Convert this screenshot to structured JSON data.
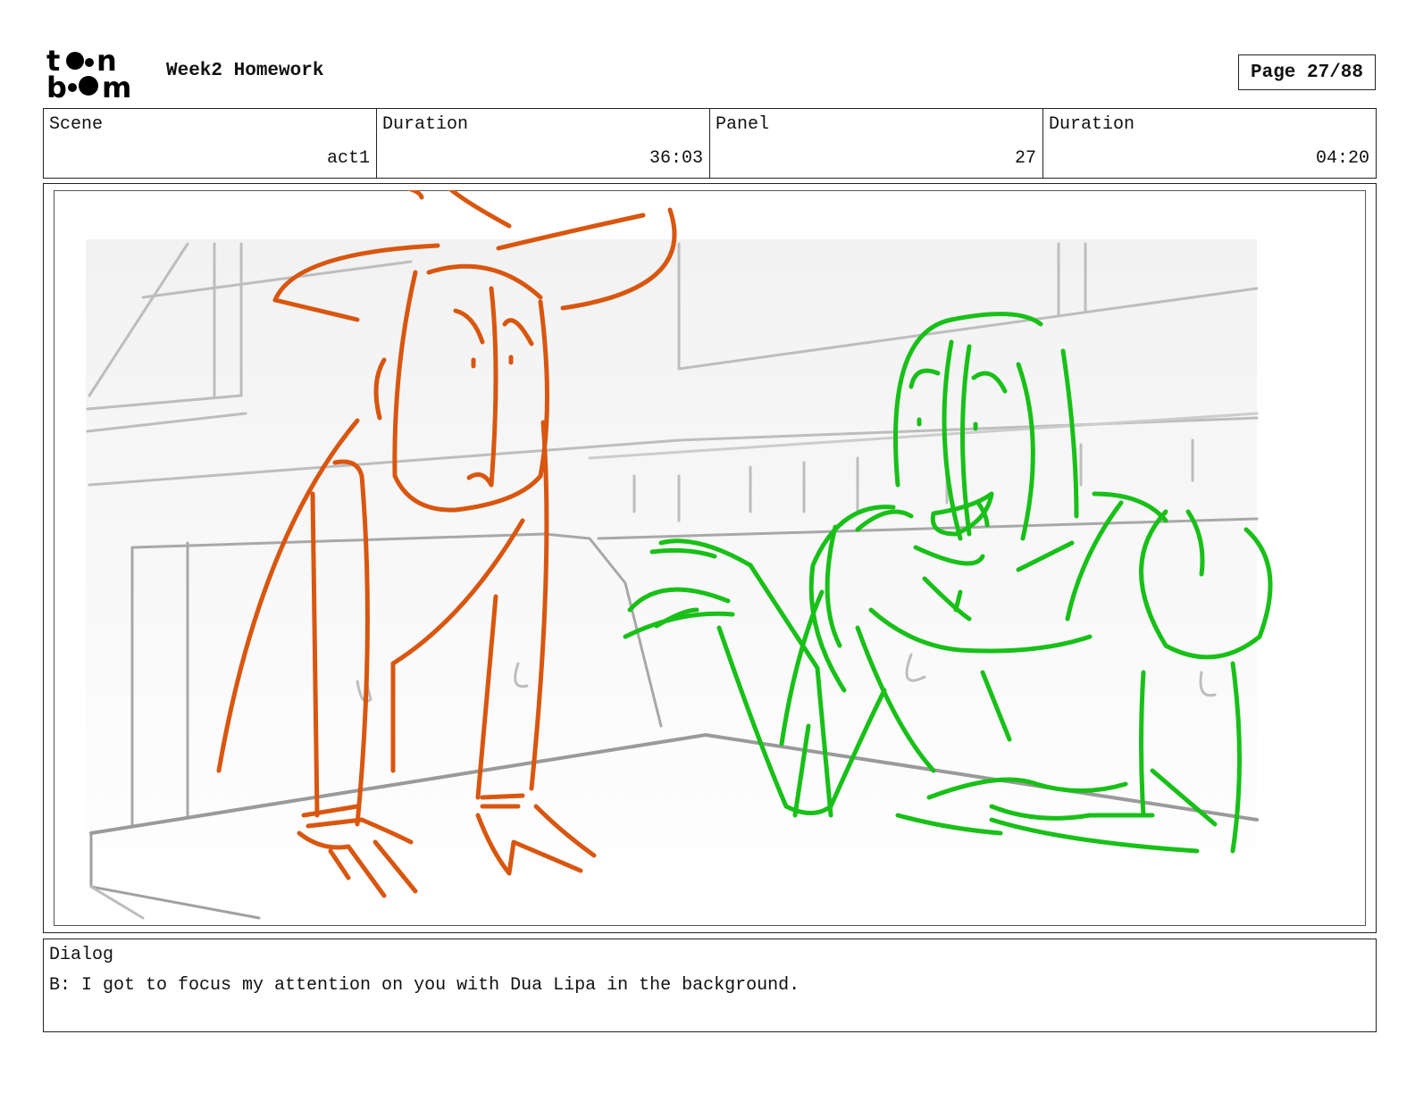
{
  "header": {
    "logo_text": "toon boom",
    "project_title": "Week2 Homework",
    "page_indicator": "Page 27/88"
  },
  "info_table": [
    {
      "label": "Scene",
      "value": "act1"
    },
    {
      "label": "Duration",
      "value": "36:03"
    },
    {
      "label": "Panel",
      "value": "27"
    },
    {
      "label": "Duration",
      "value": "04:20"
    }
  ],
  "panel": {
    "sketch_colors": {
      "character_left": "#d9560f",
      "character_right": "#18c018",
      "background": "#b8b8b8"
    }
  },
  "dialog": {
    "label": "Dialog",
    "text": "B: I got to focus my attention on you with Dua Lipa in the background."
  }
}
